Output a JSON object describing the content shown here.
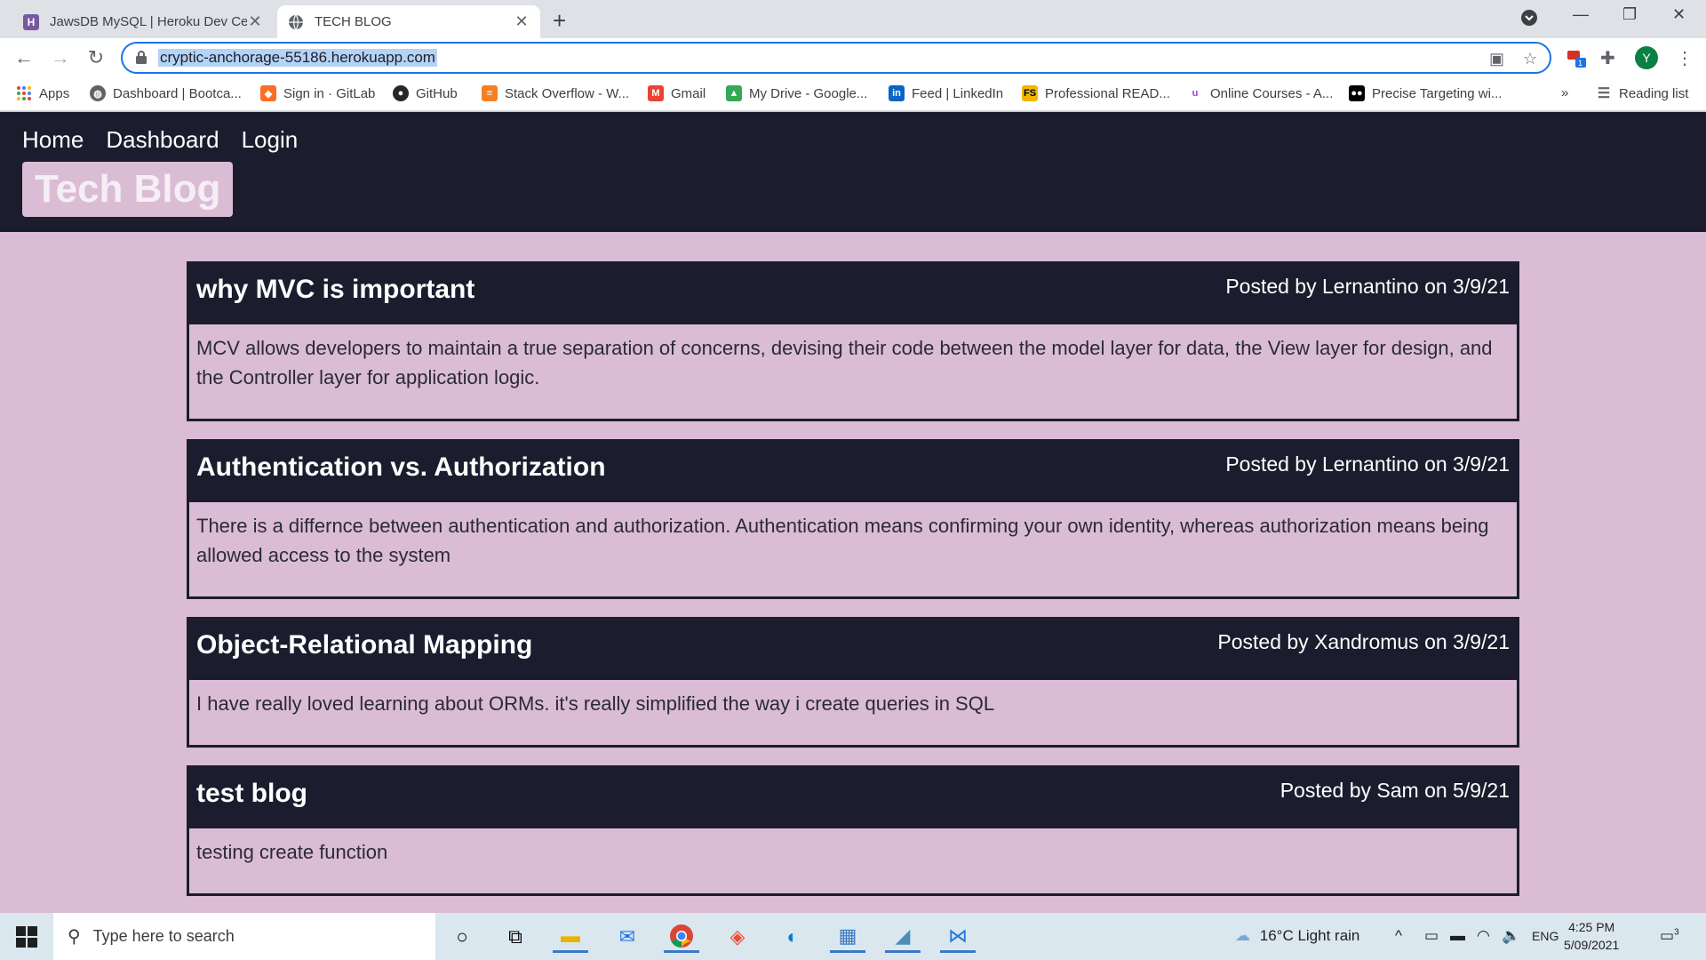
{
  "browser": {
    "tabs": [
      {
        "label": "JawsDB MySQL | Heroku Dev Cen",
        "favicon": "H",
        "favicon_color": "#79589f"
      },
      {
        "label": "TECH BLOG",
        "favicon": "globe-icon"
      }
    ],
    "url": "cryptic-anchorage-55186.herokuapp.com",
    "avatar_letter": "Y",
    "extension_badge": "1",
    "bookmarks": [
      {
        "label": "Apps",
        "icon": "apps-grid-icon"
      },
      {
        "label": "Dashboard | Bootca...",
        "icon": "globe-icon"
      },
      {
        "label": "Sign in · GitLab",
        "icon": "gitlab-icon"
      },
      {
        "label": "GitHub",
        "icon": "github-icon"
      },
      {
        "label": "Stack Overflow - W...",
        "icon": "stackoverflow-icon"
      },
      {
        "label": "Gmail",
        "icon": "gmail-icon"
      },
      {
        "label": "My Drive - Google...",
        "icon": "drive-icon"
      },
      {
        "label": "Feed | LinkedIn",
        "icon": "linkedin-icon"
      },
      {
        "label": "Professional READ...",
        "icon": "fs-icon"
      },
      {
        "label": "Online Courses - A...",
        "icon": "udemy-icon"
      },
      {
        "label": "Precise Targeting wi...",
        "icon": "precise-icon"
      }
    ],
    "more_bookmarks": "»",
    "reading_list": "Reading list"
  },
  "site": {
    "nav": [
      "Home",
      "Dashboard",
      "Login"
    ],
    "logo": "Tech Blog"
  },
  "posts": [
    {
      "title": "why MVC is important",
      "meta": "Posted by Lernantino on 3/9/21",
      "body": "MCV allows developers to maintain a true separation of concerns, devising their code between the model layer for data, the View layer for design, and the Controller layer for application logic."
    },
    {
      "title": "Authentication vs. Authorization",
      "meta": "Posted by Lernantino on 3/9/21",
      "body": "There is a differnce between authentication and authorization. Authentication means confirming your own identity, whereas authorization means being allowed access to the system"
    },
    {
      "title": "Object-Relational Mapping",
      "meta": "Posted by Xandromus on 3/9/21",
      "body": "I have really loved learning about ORMs. it's really simplified the way i create queries in SQL"
    },
    {
      "title": "test blog",
      "meta": "Posted by Sam on 5/9/21",
      "body": "testing create function"
    }
  ],
  "taskbar": {
    "search_placeholder": "Type here to search",
    "weather": "16°C  Light rain",
    "language": "ENG",
    "time": "4:25 PM",
    "date": "5/09/2021",
    "notifications": "3"
  },
  "colors": {
    "header_bg": "#1b1d2e",
    "page_bg": "#dbbcd5",
    "accent": "#1a73e8"
  }
}
